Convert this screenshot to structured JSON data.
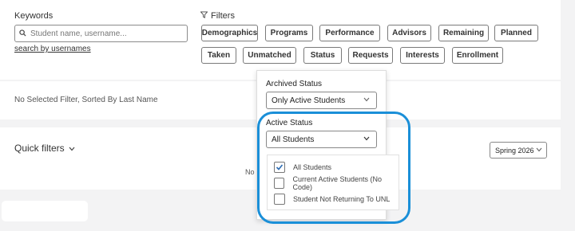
{
  "search": {
    "label": "Keywords",
    "placeholder": "Student name, username...",
    "value": "",
    "usernames_link": "search by usernames"
  },
  "filters": {
    "label": "Filters",
    "row1": [
      "Demographics",
      "Programs",
      "Performance",
      "Advisors",
      "Remaining",
      "Planned"
    ],
    "row2": [
      "Taken",
      "Unmatched",
      "Status",
      "Requests",
      "Interests",
      "Enrollment"
    ]
  },
  "summary": {
    "text": "No Selected Filter, Sorted By Last Name"
  },
  "quick_filters": {
    "label": "Quick filters",
    "partial_text": "No",
    "term_value": "Spring 2026"
  },
  "status_dropdown": {
    "archived_label": "Archived Status",
    "archived_value": "Only Active Students",
    "active_label": "Active Status",
    "active_value": "All Students",
    "options": [
      {
        "label": "All Students",
        "checked": true
      },
      {
        "label": "Current Active Students (No Code)",
        "checked": false
      },
      {
        "label": "Student Not Returning To UNL",
        "checked": false
      }
    ]
  },
  "colors": {
    "highlight": "#1a8fd8",
    "check": "#2c6cb3"
  }
}
